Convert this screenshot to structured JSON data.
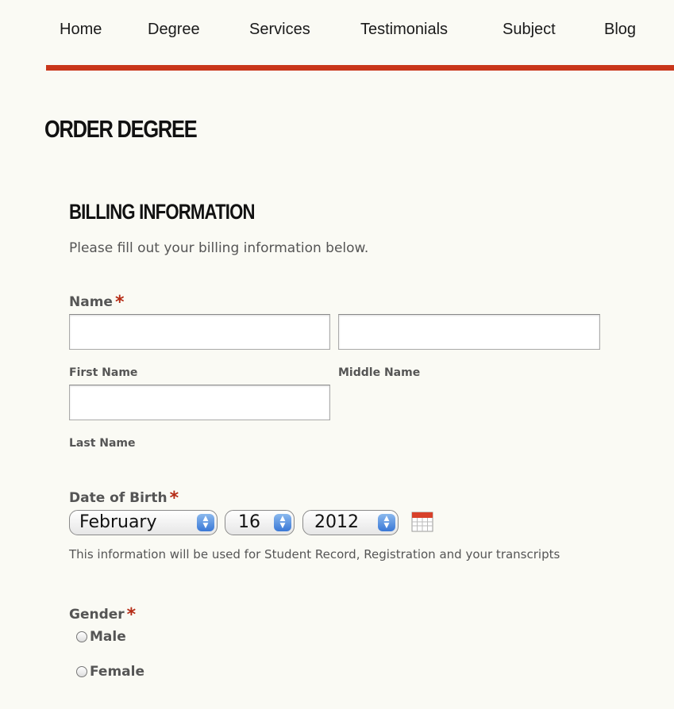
{
  "nav": {
    "items": [
      "Home",
      "Degree",
      "Services",
      "Testimonials",
      "Subject",
      "Blog"
    ]
  },
  "page_title": "ORDER DEGREE",
  "billing": {
    "title": "BILLING INFORMATION",
    "intro": "Please fill out your billing information below.",
    "name_label": "Name",
    "required_mark": "*",
    "first_name_label": "First Name",
    "middle_name_label": "Middle Name",
    "last_name_label": "Last Name",
    "first_name_value": "",
    "middle_name_value": "",
    "last_name_value": "",
    "dob_label": "Date of Birth",
    "dob_month": "February",
    "dob_day": "16",
    "dob_year": "2012",
    "dob_helper": "This information will be used for Student Record, Registration and your transcripts",
    "gender_label": "Gender",
    "gender_options": [
      "Male",
      "Female"
    ]
  },
  "colors": {
    "accent": "#c9361a",
    "required": "#b52b15",
    "background": "#fafaf4"
  },
  "icons": {
    "calendar": "calendar-icon",
    "select_arrows": "up-down-arrows-icon",
    "radio": "radio-button-icon"
  }
}
